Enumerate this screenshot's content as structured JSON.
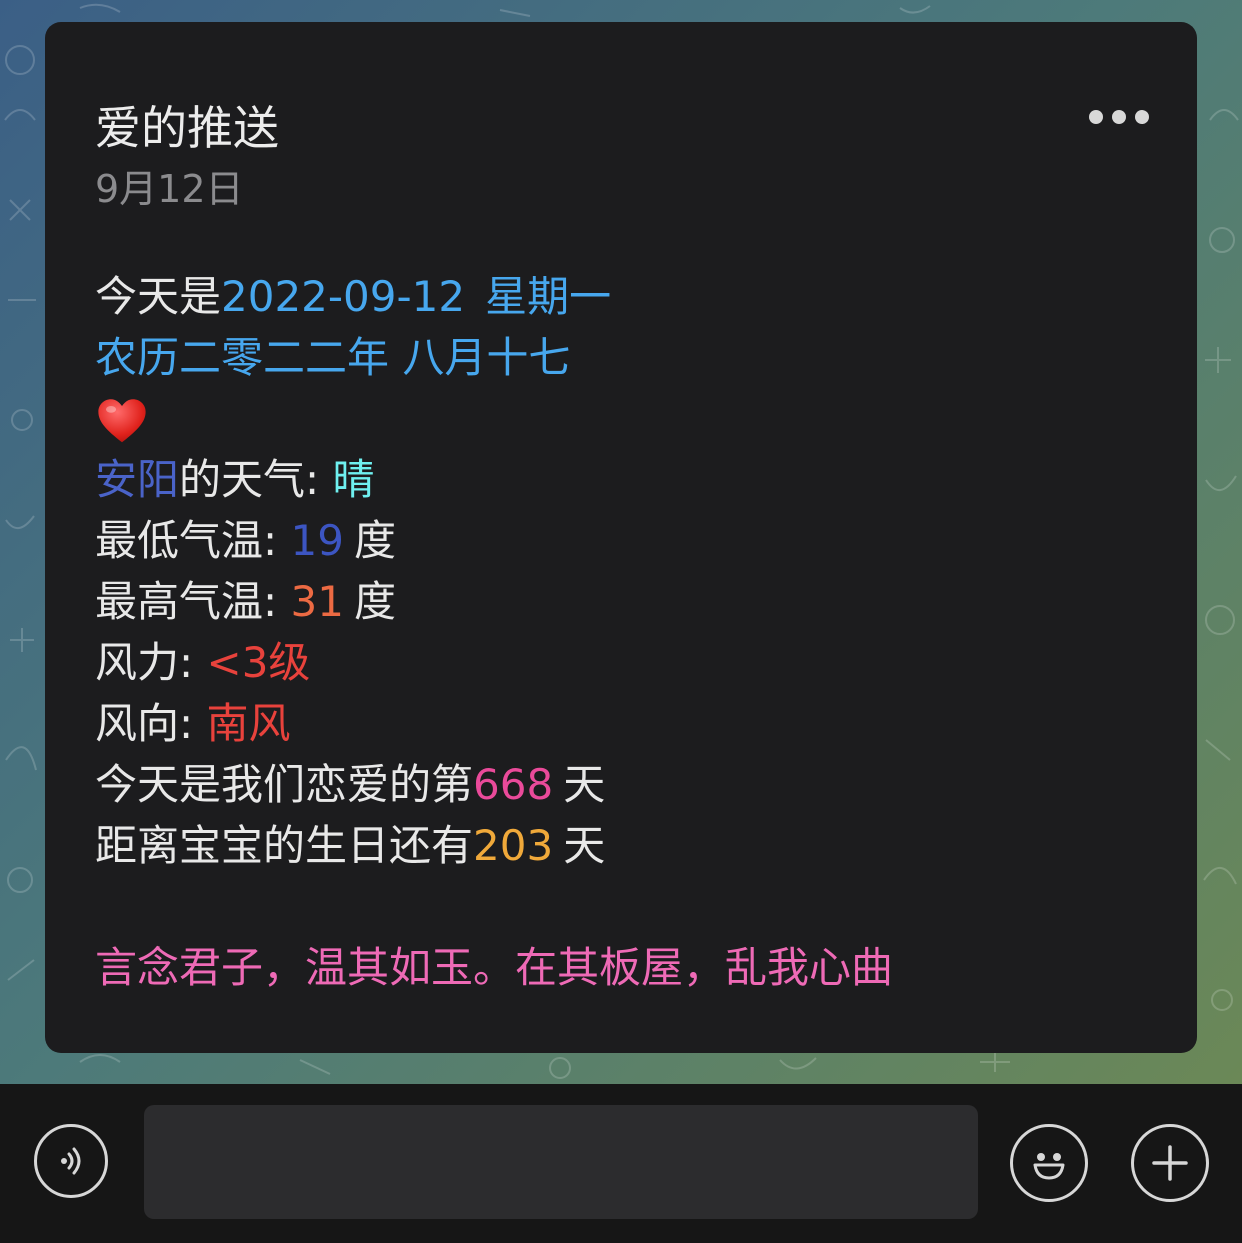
{
  "message": {
    "title": "爱的推送",
    "date": "9月12日",
    "lines": {
      "l1_prefix": "今天是",
      "l1_date": "2022-09-12",
      "l1_weekday": "星期一",
      "l2_lunar": "农历二零二二年 八月十七",
      "heart_emoji": "red-heart",
      "l4_city": "安阳",
      "l4_mid": "的天气: ",
      "l4_weather": "晴",
      "l5_label": "最低气温: ",
      "l5_value": "19",
      "l5_unit": "度",
      "l6_label": "最高气温: ",
      "l6_value": "31",
      "l6_unit": "度",
      "l7_label": "风力: ",
      "l7_value": "<3级",
      "l8_label": "风向: ",
      "l8_value": "南风",
      "l9_prefix": "今天是我们恋爱的第",
      "l9_value": "668",
      "l9_suffix": "天",
      "l10_prefix": "距离宝宝的生日还有",
      "l10_value": "203",
      "l10_suffix": "天",
      "poem": "言念君子，温其如玉。在其板屋，乱我心曲"
    }
  },
  "input_bar": {
    "placeholder": ""
  },
  "colors": {
    "card_bg": "#1c1c1e",
    "date_blue": "#47a7ee",
    "city": "#4a63c9",
    "weather": "#6ff0f0",
    "low_temp": "#3c55c2",
    "high_temp": "#ec6a43",
    "wind": "#e8423c",
    "love_days": "#ea4a9a",
    "birthday_days": "#f0a93a",
    "poem": "#ee6ab6"
  }
}
